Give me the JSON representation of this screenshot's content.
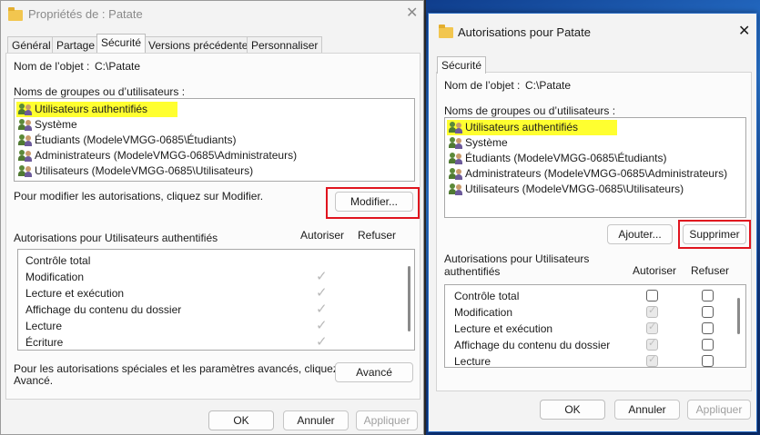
{
  "window1": {
    "title": "Propriétés de : Patate",
    "close": "✕",
    "tabs": [
      "Général",
      "Partage",
      "Sécurité",
      "Versions précédentes",
      "Personnaliser"
    ],
    "object_label": "Nom de l’objet :",
    "object_value": "C:\\Patate",
    "groups_label": "Noms de groupes ou d’utilisateurs :",
    "users": [
      "Utilisateurs authentifiés",
      "Système",
      "Étudiants (ModeleVMGG-0685\\Étudiants)",
      "Administrateurs (ModeleVMGG-0685\\Administrateurs)",
      "Utilisateurs (ModeleVMGG-0685\\Utilisateurs)"
    ],
    "modify_hint": "Pour modifier les autorisations, cliquez sur Modifier.",
    "modify_button": "Modifier...",
    "perm_header": "Autorisations pour Utilisateurs authentifiés",
    "allow_header": "Autoriser",
    "deny_header": "Refuser",
    "permissions": [
      "Contrôle total",
      "Modification",
      "Lecture et exécution",
      "Affichage du contenu du dossier",
      "Lecture",
      "Écriture"
    ],
    "allowed": [
      false,
      true,
      true,
      true,
      true,
      true
    ],
    "advanced_hint_1": "Pour les autorisations spéciales et les paramètres avancés, cliquez sur",
    "advanced_hint_2": "Avancé.",
    "advanced_button": "Avancé",
    "ok": "OK",
    "cancel": "Annuler",
    "apply": "Appliquer"
  },
  "window2": {
    "title": "Autorisations pour Patate",
    "close": "✕",
    "tab": "Sécurité",
    "object_label": "Nom de l’objet :",
    "object_value": "C:\\Patate",
    "groups_label": "Noms de groupes ou d’utilisateurs :",
    "users": [
      "Utilisateurs authentifiés",
      "Système",
      "Étudiants (ModeleVMGG-0685\\Étudiants)",
      "Administrateurs (ModeleVMGG-0685\\Administrateurs)",
      "Utilisateurs (ModeleVMGG-0685\\Utilisateurs)"
    ],
    "add_button": "Ajouter...",
    "remove_button": "Supprimer",
    "perm_header_1": "Autorisations pour Utilisateurs",
    "perm_header_2": "authentifiés",
    "allow_header": "Autoriser",
    "deny_header": "Refuser",
    "permissions": [
      "Contrôle total",
      "Modification",
      "Lecture et exécution",
      "Affichage du contenu du dossier",
      "Lecture"
    ],
    "allow_state": [
      "unchecked",
      "disabled-checked",
      "disabled-checked",
      "disabled-checked",
      "disabled-checked"
    ],
    "deny_state": [
      "unchecked",
      "unchecked",
      "unchecked",
      "unchecked",
      "unchecked"
    ],
    "ok": "OK",
    "cancel": "Annuler",
    "apply": "Appliquer"
  },
  "colors": {
    "highlight": "#ffff30",
    "annotation": "#e0141e",
    "accent": "#2d6fc7"
  }
}
